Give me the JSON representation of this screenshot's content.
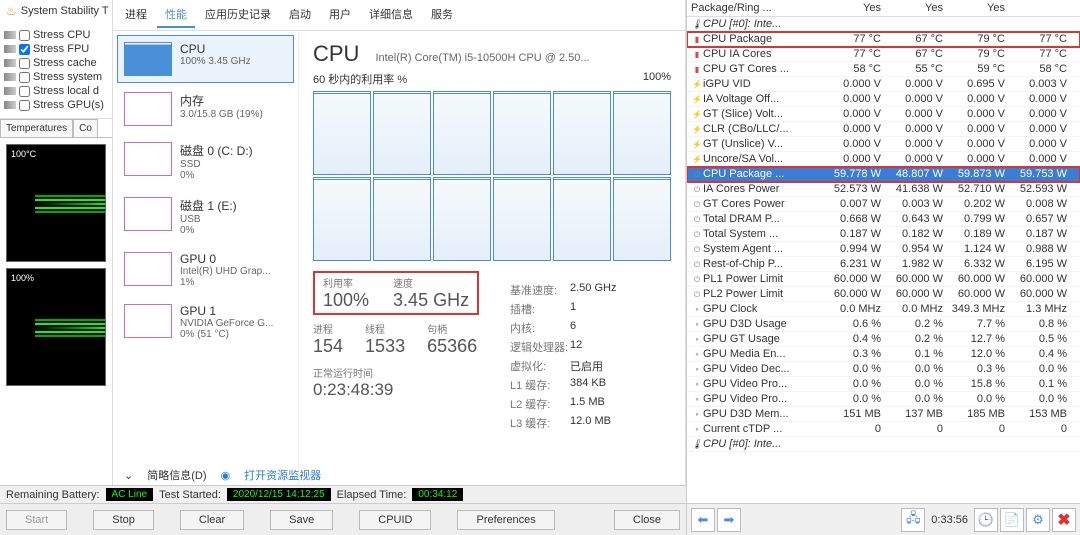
{
  "sst": {
    "title": "System Stability T",
    "checks": [
      {
        "label": "Stress CPU",
        "checked": false
      },
      {
        "label": "Stress FPU",
        "checked": true
      },
      {
        "label": "Stress cache",
        "checked": false
      },
      {
        "label": "Stress system",
        "checked": false
      },
      {
        "label": "Stress local d",
        "checked": false
      },
      {
        "label": "Stress GPU(s)",
        "checked": false
      }
    ],
    "tabs": [
      "Temperatures",
      "Co"
    ],
    "graph_labels": [
      "100°C",
      "100%"
    ]
  },
  "status_bar": {
    "battery_lbl": "Remaining Battery:",
    "battery_val": "AC Line",
    "test_lbl": "Test Started:",
    "test_val": "2020/12/15 14:12:25",
    "elapsed_lbl": "Elapsed Time:",
    "elapsed_val": "00:34:12"
  },
  "buttons": {
    "start": "Start",
    "stop": "Stop",
    "clear": "Clear",
    "save": "Save",
    "cpuid": "CPUID",
    "prefs": "Preferences",
    "close": "Close"
  },
  "tm": {
    "tabs": [
      "进程",
      "性能",
      "应用历史记录",
      "启动",
      "用户",
      "详细信息",
      "服务"
    ],
    "active": 1,
    "side": [
      {
        "title": "CPU",
        "sub": "100% 3.45 GHz",
        "sel": true
      },
      {
        "title": "内存",
        "sub": "3.0/15.8 GB (19%)"
      },
      {
        "title": "磁盘 0 (C: D:)",
        "sub": "SSD",
        "third": "0%"
      },
      {
        "title": "磁盘 1 (E:)",
        "sub": "USB",
        "third": "0%"
      },
      {
        "title": "GPU 0",
        "sub": "Intel(R) UHD Grap...",
        "third": "1%"
      },
      {
        "title": "GPU 1",
        "sub": "NVIDIA GeForce G...",
        "third": "0% (51 °C)"
      }
    ],
    "title": "CPU",
    "subtitle": "Intel(R) Core(TM) i5-10500H CPU @ 2.50...",
    "axis_left": "60 秒内的利用率 %",
    "axis_right": "100%",
    "util_lbl": "利用率",
    "util_val": "100%",
    "speed_lbl": "速度",
    "speed_val": "3.45 GHz",
    "proc_lbl": "进程",
    "proc_val": "154",
    "thread_lbl": "线程",
    "thread_val": "1533",
    "handle_lbl": "句柄",
    "handle_val": "65366",
    "uptime_lbl": "正常运行时间",
    "uptime_val": "0:23:48:39",
    "specs": [
      [
        "基准速度:",
        "2.50 GHz"
      ],
      [
        "插槽:",
        "1"
      ],
      [
        "内核:",
        "6"
      ],
      [
        "逻辑处理器:",
        "12"
      ],
      [
        "虚拟化:",
        "已启用"
      ],
      [
        "L1 缓存:",
        "384 KB"
      ],
      [
        "L2 缓存:",
        "1.5 MB"
      ],
      [
        "L3 缓存:",
        "12.0 MB"
      ]
    ]
  },
  "simple": {
    "collapse": "简略信息(D)",
    "link": "打开资源监视器"
  },
  "sensors": {
    "header": {
      "name": "Package/Ring ...",
      "c1": "Yes",
      "c2": "Yes",
      "c3": "Yes",
      "c4": ""
    },
    "section1": "CPU [#0]: Inte...",
    "rows": [
      {
        "ic": "thermo",
        "nm": "CPU Package",
        "v": [
          "77 °C",
          "67 °C",
          "79 °C",
          "77 °C"
        ],
        "hl": true
      },
      {
        "ic": "thermo",
        "nm": "CPU IA Cores",
        "v": [
          "77 °C",
          "67 °C",
          "79 °C",
          "77 °C"
        ]
      },
      {
        "ic": "thermo",
        "nm": "CPU GT Cores ...",
        "v": [
          "58 °C",
          "55 °C",
          "59 °C",
          "58 °C"
        ]
      },
      {
        "ic": "bolt",
        "nm": "iGPU VID",
        "v": [
          "0.000 V",
          "0.000 V",
          "0.695 V",
          "0.003 V"
        ]
      },
      {
        "ic": "bolt",
        "nm": "IA Voltage Off...",
        "v": [
          "0.000 V",
          "0.000 V",
          "0.000 V",
          "0.000 V"
        ]
      },
      {
        "ic": "bolt",
        "nm": "GT (Slice) Volt...",
        "v": [
          "0.000 V",
          "0.000 V",
          "0.000 V",
          "0.000 V"
        ]
      },
      {
        "ic": "bolt",
        "nm": "CLR (CBo/LLC/...",
        "v": [
          "0.000 V",
          "0.000 V",
          "0.000 V",
          "0.000 V"
        ]
      },
      {
        "ic": "bolt",
        "nm": "GT (Unslice) V...",
        "v": [
          "0.000 V",
          "0.000 V",
          "0.000 V",
          "0.000 V"
        ]
      },
      {
        "ic": "bolt",
        "nm": "Uncore/SA Vol...",
        "v": [
          "0.000 V",
          "0.000 V",
          "0.000 V",
          "0.000 V"
        ]
      },
      {
        "ic": "plug",
        "nm": "CPU Package ...",
        "v": [
          "59.778 W",
          "48.807 W",
          "59.873 W",
          "59.753 W"
        ],
        "blue": true,
        "hl": true
      },
      {
        "ic": "plug",
        "nm": "IA Cores Power",
        "v": [
          "52.573 W",
          "41.638 W",
          "52.710 W",
          "52.593 W"
        ]
      },
      {
        "ic": "plug",
        "nm": "GT Cores Power",
        "v": [
          "0.007 W",
          "0.003 W",
          "0.202 W",
          "0.008 W"
        ]
      },
      {
        "ic": "plug",
        "nm": "Total DRAM P...",
        "v": [
          "0.668 W",
          "0.643 W",
          "0.799 W",
          "0.657 W"
        ]
      },
      {
        "ic": "plug",
        "nm": "Total System ...",
        "v": [
          "0.187 W",
          "0.182 W",
          "0.189 W",
          "0.187 W"
        ]
      },
      {
        "ic": "plug",
        "nm": "System Agent ...",
        "v": [
          "0.994 W",
          "0.954 W",
          "1.124 W",
          "0.988 W"
        ]
      },
      {
        "ic": "plug",
        "nm": "Rest-of-Chip P...",
        "v": [
          "6.231 W",
          "1.982 W",
          "6.332 W",
          "6.195 W"
        ]
      },
      {
        "ic": "plug",
        "nm": "PL1 Power Limit",
        "v": [
          "60.000 W",
          "60.000 W",
          "60.000 W",
          "60.000 W"
        ]
      },
      {
        "ic": "plug",
        "nm": "PL2 Power Limit",
        "v": [
          "60.000 W",
          "60.000 W",
          "60.000 W",
          "60.000 W"
        ]
      },
      {
        "ic": "",
        "nm": "GPU Clock",
        "v": [
          "0.0 MHz",
          "0.0 MHz",
          "349.3 MHz",
          "1.3 MHz"
        ]
      },
      {
        "ic": "",
        "nm": "GPU D3D Usage",
        "v": [
          "0.6 %",
          "0.2 %",
          "7.7 %",
          "0.8 %"
        ]
      },
      {
        "ic": "",
        "nm": "GPU GT Usage",
        "v": [
          "0.4 %",
          "0.2 %",
          "12.7 %",
          "0.5 %"
        ]
      },
      {
        "ic": "",
        "nm": "GPU Media En...",
        "v": [
          "0.3 %",
          "0.1 %",
          "12.0 %",
          "0.4 %"
        ]
      },
      {
        "ic": "",
        "nm": "GPU Video Dec...",
        "v": [
          "0.0 %",
          "0.0 %",
          "0.3 %",
          "0.0 %"
        ]
      },
      {
        "ic": "",
        "nm": "GPU Video Pro...",
        "v": [
          "0.0 %",
          "0.0 %",
          "15.8 %",
          "0.1 %"
        ]
      },
      {
        "ic": "",
        "nm": "GPU Video Pro...",
        "v": [
          "0.0 %",
          "0.0 %",
          "0.0 %",
          "0.0 %"
        ]
      },
      {
        "ic": "",
        "nm": "GPU D3D Mem...",
        "v": [
          "151 MB",
          "137 MB",
          "185 MB",
          "153 MB"
        ]
      },
      {
        "ic": "",
        "nm": "Current cTDP ...",
        "v": [
          "0",
          "0",
          "0",
          "0"
        ]
      }
    ],
    "section2": "CPU [#0]: Inte...",
    "foot_time": "0:33:56"
  }
}
